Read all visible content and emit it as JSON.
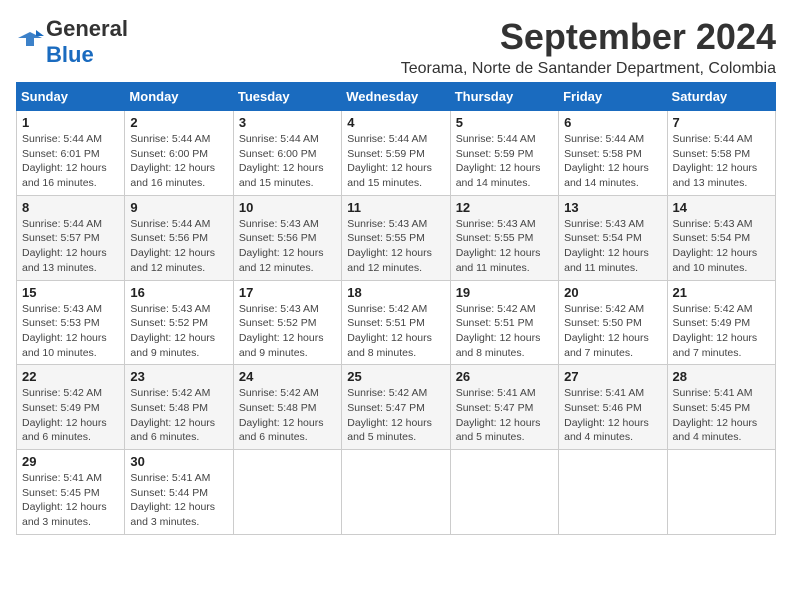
{
  "header": {
    "logo_general": "General",
    "logo_blue": "Blue",
    "month": "September 2024",
    "location": "Teorama, Norte de Santander Department, Colombia"
  },
  "weekdays": [
    "Sunday",
    "Monday",
    "Tuesday",
    "Wednesday",
    "Thursday",
    "Friday",
    "Saturday"
  ],
  "weeks": [
    [
      {
        "day": "1",
        "sunrise": "5:44 AM",
        "sunset": "6:01 PM",
        "daylight": "12 hours and 16 minutes."
      },
      {
        "day": "2",
        "sunrise": "5:44 AM",
        "sunset": "6:00 PM",
        "daylight": "12 hours and 16 minutes."
      },
      {
        "day": "3",
        "sunrise": "5:44 AM",
        "sunset": "6:00 PM",
        "daylight": "12 hours and 15 minutes."
      },
      {
        "day": "4",
        "sunrise": "5:44 AM",
        "sunset": "5:59 PM",
        "daylight": "12 hours and 15 minutes."
      },
      {
        "day": "5",
        "sunrise": "5:44 AM",
        "sunset": "5:59 PM",
        "daylight": "12 hours and 14 minutes."
      },
      {
        "day": "6",
        "sunrise": "5:44 AM",
        "sunset": "5:58 PM",
        "daylight": "12 hours and 14 minutes."
      },
      {
        "day": "7",
        "sunrise": "5:44 AM",
        "sunset": "5:58 PM",
        "daylight": "12 hours and 13 minutes."
      }
    ],
    [
      {
        "day": "8",
        "sunrise": "5:44 AM",
        "sunset": "5:57 PM",
        "daylight": "12 hours and 13 minutes."
      },
      {
        "day": "9",
        "sunrise": "5:44 AM",
        "sunset": "5:56 PM",
        "daylight": "12 hours and 12 minutes."
      },
      {
        "day": "10",
        "sunrise": "5:43 AM",
        "sunset": "5:56 PM",
        "daylight": "12 hours and 12 minutes."
      },
      {
        "day": "11",
        "sunrise": "5:43 AM",
        "sunset": "5:55 PM",
        "daylight": "12 hours and 12 minutes."
      },
      {
        "day": "12",
        "sunrise": "5:43 AM",
        "sunset": "5:55 PM",
        "daylight": "12 hours and 11 minutes."
      },
      {
        "day": "13",
        "sunrise": "5:43 AM",
        "sunset": "5:54 PM",
        "daylight": "12 hours and 11 minutes."
      },
      {
        "day": "14",
        "sunrise": "5:43 AM",
        "sunset": "5:54 PM",
        "daylight": "12 hours and 10 minutes."
      }
    ],
    [
      {
        "day": "15",
        "sunrise": "5:43 AM",
        "sunset": "5:53 PM",
        "daylight": "12 hours and 10 minutes."
      },
      {
        "day": "16",
        "sunrise": "5:43 AM",
        "sunset": "5:52 PM",
        "daylight": "12 hours and 9 minutes."
      },
      {
        "day": "17",
        "sunrise": "5:43 AM",
        "sunset": "5:52 PM",
        "daylight": "12 hours and 9 minutes."
      },
      {
        "day": "18",
        "sunrise": "5:42 AM",
        "sunset": "5:51 PM",
        "daylight": "12 hours and 8 minutes."
      },
      {
        "day": "19",
        "sunrise": "5:42 AM",
        "sunset": "5:51 PM",
        "daylight": "12 hours and 8 minutes."
      },
      {
        "day": "20",
        "sunrise": "5:42 AM",
        "sunset": "5:50 PM",
        "daylight": "12 hours and 7 minutes."
      },
      {
        "day": "21",
        "sunrise": "5:42 AM",
        "sunset": "5:49 PM",
        "daylight": "12 hours and 7 minutes."
      }
    ],
    [
      {
        "day": "22",
        "sunrise": "5:42 AM",
        "sunset": "5:49 PM",
        "daylight": "12 hours and 6 minutes."
      },
      {
        "day": "23",
        "sunrise": "5:42 AM",
        "sunset": "5:48 PM",
        "daylight": "12 hours and 6 minutes."
      },
      {
        "day": "24",
        "sunrise": "5:42 AM",
        "sunset": "5:48 PM",
        "daylight": "12 hours and 6 minutes."
      },
      {
        "day": "25",
        "sunrise": "5:42 AM",
        "sunset": "5:47 PM",
        "daylight": "12 hours and 5 minutes."
      },
      {
        "day": "26",
        "sunrise": "5:41 AM",
        "sunset": "5:47 PM",
        "daylight": "12 hours and 5 minutes."
      },
      {
        "day": "27",
        "sunrise": "5:41 AM",
        "sunset": "5:46 PM",
        "daylight": "12 hours and 4 minutes."
      },
      {
        "day": "28",
        "sunrise": "5:41 AM",
        "sunset": "5:45 PM",
        "daylight": "12 hours and 4 minutes."
      }
    ],
    [
      {
        "day": "29",
        "sunrise": "5:41 AM",
        "sunset": "5:45 PM",
        "daylight": "12 hours and 3 minutes."
      },
      {
        "day": "30",
        "sunrise": "5:41 AM",
        "sunset": "5:44 PM",
        "daylight": "12 hours and 3 minutes."
      },
      null,
      null,
      null,
      null,
      null
    ]
  ]
}
